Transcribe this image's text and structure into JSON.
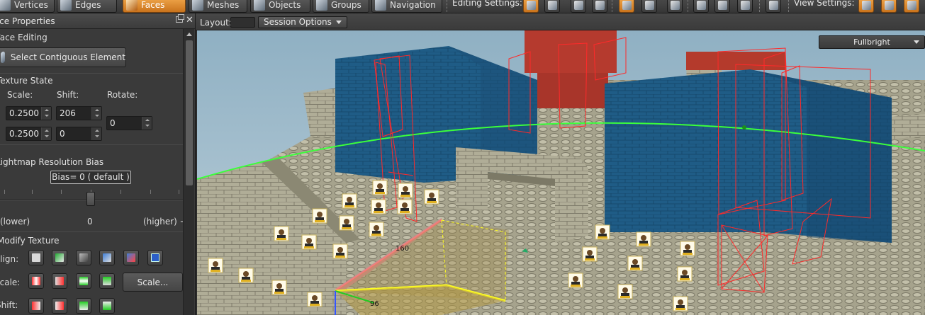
{
  "toolbar": {
    "mode_tabs": [
      {
        "label": "Vertices",
        "icon": "vertex-icon"
      },
      {
        "label": "Edges",
        "icon": "edge-icon"
      },
      {
        "label": "Faces",
        "icon": "face-icon",
        "active": true
      },
      {
        "label": "Meshes",
        "icon": "mesh-icon"
      },
      {
        "label": "Objects",
        "icon": "object-icon"
      },
      {
        "label": "Groups",
        "icon": "group-icon"
      },
      {
        "label": "Navigation",
        "icon": "navigation-icon"
      }
    ],
    "editing_settings_label": "Editing Settings:",
    "view_settings_label": "View Settings:"
  },
  "panel": {
    "title": "Face Properties",
    "face_editing_header": "Face Editing",
    "select_contiguous_label": "Select Contiguous Element",
    "texture_state_header": "Texture State",
    "scale_label": "Scale:",
    "shift_label": "Shift:",
    "rotate_label": "Rotate:",
    "scale_u": "0.2500",
    "scale_v": "0.2500",
    "shift_u": "206",
    "shift_v": "0",
    "rotate": "0",
    "lightmap_header": "Lightmap Resolution Bias",
    "bias_value": "Bias= 0 ( default )",
    "slider_fraction": 0.5,
    "slider_min_label": "(lower)",
    "slider_mid_label": "0",
    "slider_max_label": "(higher) +",
    "modify_texture_header": "Modify Texture",
    "align_label": "Align:",
    "scale_row_label": "Scale:",
    "shift_row_label": "Shift:",
    "scale_button": "Scale..."
  },
  "viewport": {
    "layout_label": "Layout:",
    "session_options": "Session Options",
    "view_mode": "Fullbright",
    "measure_labels": [
      "160",
      "96"
    ]
  },
  "colors": {
    "accent_orange": "#e4902f",
    "sky": "#a9c1cf",
    "blue_block": "#1f5c86",
    "selection_red": "#ff2a2a",
    "arc_green": "#3bff3b",
    "selection_yellow": "#ffff22"
  }
}
